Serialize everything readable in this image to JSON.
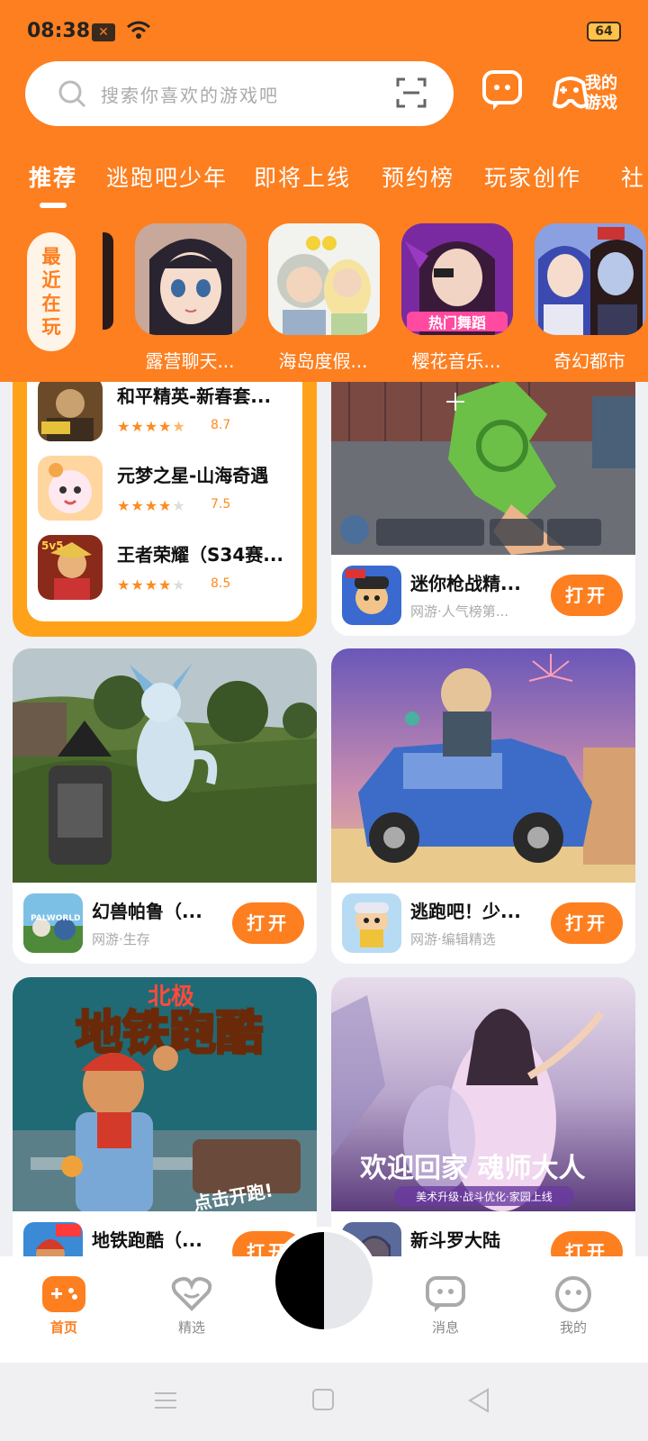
{
  "status": {
    "time": "08:38",
    "battery": "64"
  },
  "search": {
    "placeholder": "搜索你喜欢的游戏吧"
  },
  "header": {
    "my_games": "我的\n游戏"
  },
  "tabs": [
    "推荐",
    "逃跑吧少年",
    "即将上线",
    "预约榜",
    "玩家创作",
    "社"
  ],
  "recent": {
    "label": "最近在玩"
  },
  "recent_games": [
    {
      "name": "露营聊天..."
    },
    {
      "name": "海岛度假..."
    },
    {
      "name": "樱花音乐...",
      "badge": "热门舞蹈"
    },
    {
      "name": "奇幻都市"
    }
  ],
  "ranking": [
    {
      "name": "和平精英-新春套...",
      "score": "8.7",
      "stars": 4.5
    },
    {
      "name": "元梦之星-山海奇遇",
      "score": "7.5",
      "stars": 4
    },
    {
      "name": "王者荣耀（S34赛...",
      "score": "8.5",
      "stars": 4
    }
  ],
  "games": [
    {
      "name": "迷你枪战精...",
      "tag": "网游·人气榜第...",
      "button": "打开"
    },
    {
      "name": "幻兽帕鲁（...",
      "tag": "网游·生存",
      "button": "打开"
    },
    {
      "name": "逃跑吧！少...",
      "tag": "网游·编辑精选",
      "button": "打开"
    },
    {
      "name": "地铁跑酷（...",
      "tag": "",
      "button": "打开",
      "banner": "北极 地铁跑酷 点击开跑!"
    },
    {
      "name": "新斗罗大陆",
      "tag": "",
      "button": "打开",
      "banner_title": "欢迎回家 魂师大人",
      "banner_sub": "美术升级·战斗优化·家园上线"
    }
  ],
  "bottom_nav": {
    "home": "首页",
    "featured": "精选",
    "messages": "消息",
    "mine": "我的"
  },
  "colors": {
    "accent": "#fd7f20"
  }
}
